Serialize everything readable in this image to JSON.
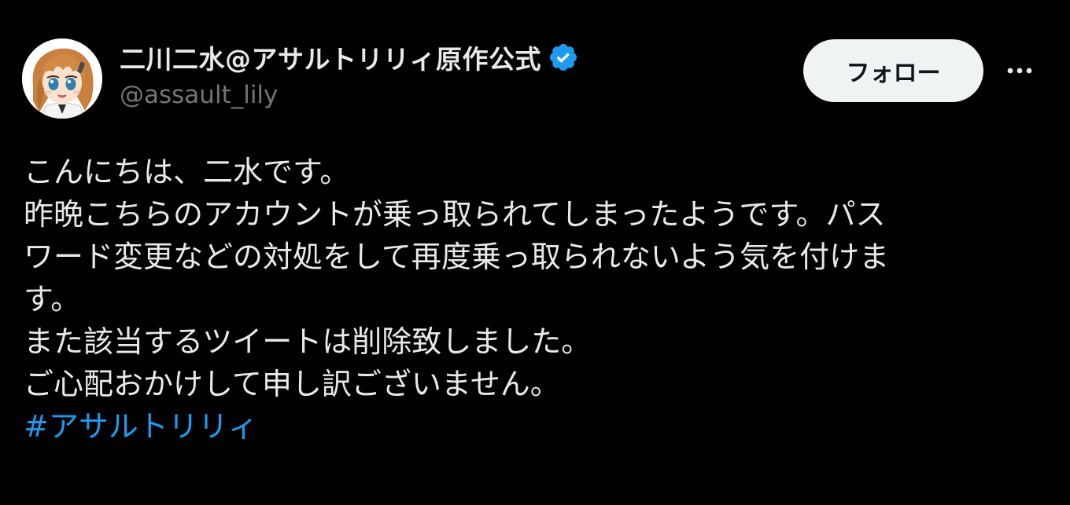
{
  "author": {
    "display_name": "二川二水@アサルトリリィ原作公式",
    "handle": "@assault_lily",
    "verified": true,
    "avatar_icon": "anime-girl-avatar-icon",
    "verified_icon": "verified-badge-icon",
    "verified_color": "#1d9bf0"
  },
  "actions": {
    "follow_label": "フォロー",
    "more_icon": "more-options-icon"
  },
  "tweet": {
    "lines": [
      "こんにちは、二水です。",
      "昨晩こちらのアカウントが乗っ取られてしまったようです。パス",
      "ワード変更などの対処をして再度乗っ取られないよう気を付けま",
      "す。",
      "また該当するツイートは削除致しました。",
      "ご心配おかけして申し訳ございません。"
    ],
    "hashtag": "#アサルトリリィ"
  },
  "colors": {
    "background": "#000000",
    "text_primary": "#e7e9ea",
    "text_secondary": "#71767b",
    "link": "#1d9bf0",
    "button_bg": "#eff3f4",
    "button_text": "#0f1419"
  }
}
